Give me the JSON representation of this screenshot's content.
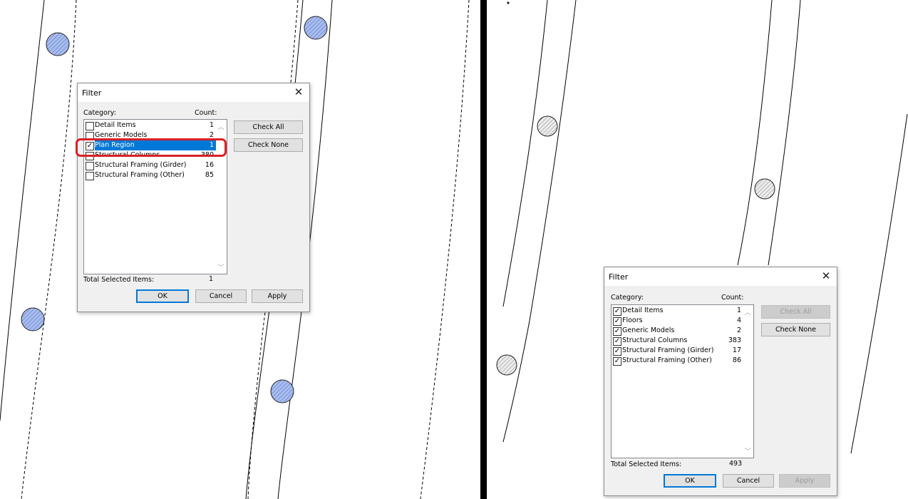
{
  "left_dialog": {
    "title": "Filter",
    "category_header": "Category:",
    "count_header": "Count:",
    "items": [
      {
        "label": "Detail Items",
        "count": "1",
        "checked": false,
        "selected": false
      },
      {
        "label": "Generic Models",
        "count": "2",
        "checked": false,
        "selected": false
      },
      {
        "label": "Plan Region",
        "count": "1",
        "checked": true,
        "selected": true
      },
      {
        "label": "Structural Columns",
        "count": "380",
        "checked": false,
        "selected": false
      },
      {
        "label": "Structural Framing (Girder)",
        "count": "16",
        "checked": false,
        "selected": false
      },
      {
        "label": "Structural Framing (Other)",
        "count": "85",
        "checked": false,
        "selected": false
      }
    ],
    "check_all": "Check All",
    "check_none": "Check None",
    "total_label": "Total Selected Items:",
    "total_value": "1",
    "ok": "OK",
    "cancel": "Cancel",
    "apply": "Apply"
  },
  "right_dialog": {
    "title": "Filter",
    "category_header": "Category:",
    "count_header": "Count:",
    "items": [
      {
        "label": "Detail Items",
        "count": "1",
        "checked": true
      },
      {
        "label": "Floors",
        "count": "4",
        "checked": true
      },
      {
        "label": "Generic Models",
        "count": "2",
        "checked": true
      },
      {
        "label": "Structural Columns",
        "count": "383",
        "checked": true
      },
      {
        "label": "Structural Framing (Girder)",
        "count": "17",
        "checked": true
      },
      {
        "label": "Structural Framing (Other)",
        "count": "86",
        "checked": true
      }
    ],
    "check_all": "Check All",
    "check_none": "Check None",
    "total_label": "Total Selected Items:",
    "total_value": "493",
    "ok": "OK",
    "cancel": "Cancel",
    "apply": "Apply"
  },
  "colors": {
    "selection": "#0078d7",
    "highlight_ring": "#d92127",
    "column_fill_left": "#9ab3e8",
    "column_fill_right": "#e6e6e6"
  }
}
